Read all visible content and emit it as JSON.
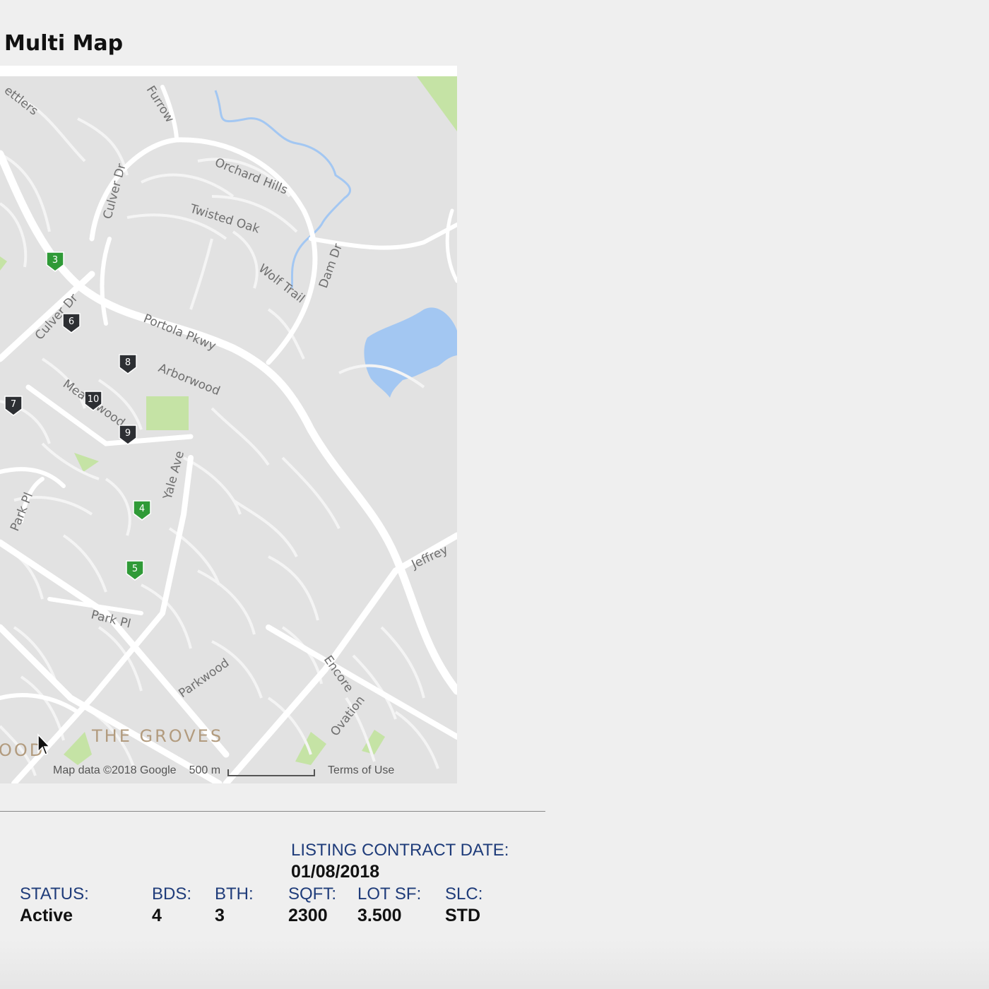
{
  "page_title": "Multi Map",
  "map": {
    "road_labels": {
      "settlers": "ettlers",
      "furrow": "Furrow",
      "orchard_hills": "Orchard Hills",
      "culver_dr_north": "Culver Dr",
      "twisted_oak": "Twisted Oak",
      "wolf_trail": "Wolf Trail",
      "dam_dr": "Dam Dr",
      "culver_dr_south": "Culver Dr",
      "portola_pkwy": "Portola Pkwy",
      "arborwood": "Arborwood",
      "meadowood": "Meadowood",
      "yale_ave": "Yale Ave",
      "park_pl_west": "Park Pl",
      "park_pl_south": "Park Pl",
      "jeffrey": "Jeffrey",
      "parkwood": "Parkwood",
      "encore": "Encore",
      "ovation": "Ovation"
    },
    "neighborhood_labels": {
      "the_groves": "THE GROVES",
      "wood_partial": "OOD"
    },
    "markers": [
      {
        "label": "3",
        "status": "active"
      },
      {
        "label": "6",
        "status": "other"
      },
      {
        "label": "8",
        "status": "other"
      },
      {
        "label": "7",
        "status": "other"
      },
      {
        "label": "10",
        "status": "other"
      },
      {
        "label": "9",
        "status": "other"
      },
      {
        "label": "4",
        "status": "active"
      },
      {
        "label": "5",
        "status": "active"
      }
    ],
    "footer": {
      "attribution": "Map data ©2018 Google",
      "scale": "500 m",
      "terms": "Terms of Use"
    },
    "colors": {
      "background": "#e2e2e2",
      "road": "#ffffff",
      "water": "#a3c7f2",
      "park": "#c5e3a5",
      "active_marker": "#2f9a37",
      "other_marker": "#2d2f33"
    }
  },
  "listing": {
    "contract_date_label": "LISTING CONTRACT DATE:",
    "contract_date": "01/08/2018",
    "status_label": "STATUS:",
    "status": "Active",
    "bds_label": "BDS:",
    "bds": "4",
    "bth_label": "BTH:",
    "bth": "3",
    "sqft_label": "SQFT:",
    "sqft": "2300",
    "lotsf_label": "LOT SF:",
    "lotsf": "3.500",
    "slc_label": "SLC:",
    "slc": "STD"
  }
}
